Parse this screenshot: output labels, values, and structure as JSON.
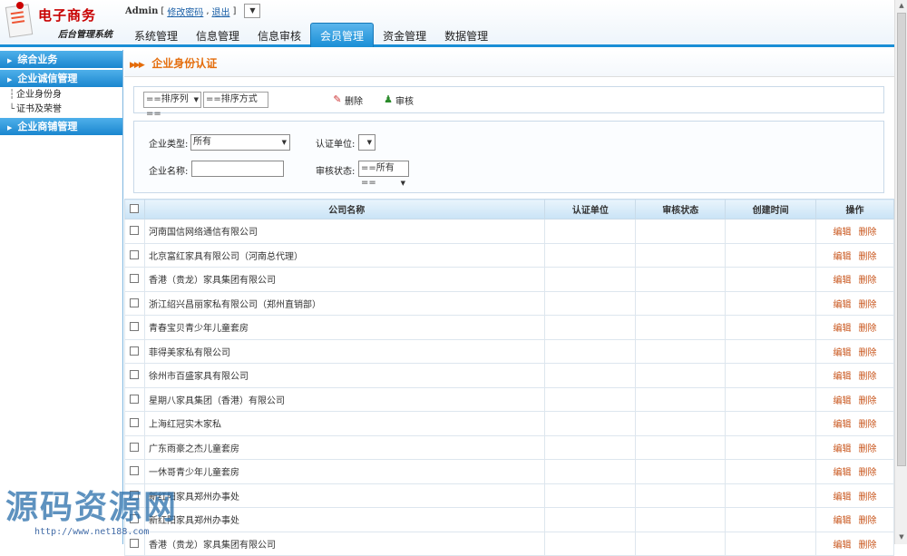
{
  "logo": {
    "title": "电子商务",
    "subtitle": "后台管理系统"
  },
  "userbar": {
    "user": "Admin",
    "open_bracket": "[",
    "change_password": "修改密码",
    "sep": ",",
    "logout": "退出",
    "close_bracket": "]",
    "dropdown": "▼"
  },
  "nav": {
    "tabs": [
      "系统管理",
      "信息管理",
      "信息审核",
      "会员管理",
      "资金管理",
      "数据管理"
    ],
    "active": "会员管理"
  },
  "sidebar": {
    "groups": [
      {
        "label": "综合业务"
      },
      {
        "label": "企业诚信管理",
        "items": [
          "企业身份身",
          "证书及荣誉"
        ]
      },
      {
        "label": "企业商铺管理"
      }
    ]
  },
  "page": {
    "title": "企业身份认证"
  },
  "toolbar": {
    "sort_column": "==排序列==",
    "sort_order": "==排序方式",
    "delete_label": "删除",
    "audit_label": "审核"
  },
  "filter": {
    "type_label": "企业类型:",
    "type_value": "所有",
    "unit_label": "认证单位:",
    "name_label": "企业名称:",
    "name_value": "",
    "status_label": "审核状态:",
    "status_value": "==所有=="
  },
  "table": {
    "columns": [
      "公司名称",
      "认证单位",
      "审核状态",
      "创建时间",
      "操作"
    ],
    "rows": [
      "河南国信网络通信有限公司",
      "北京富红家具有限公司（河南总代理）",
      "香港（贵龙）家具集团有限公司",
      "浙江绍兴昌丽家私有限公司（郑州直销部）",
      "青春宝贝青少年儿童套房",
      "菲得美家私有限公司",
      "徐州市百盛家具有限公司",
      "星期八家具集团（香港）有限公司",
      "上海红冠实木家私",
      "广东雨豪之杰儿童套房",
      "一休哥青少年儿童套房",
      "新红阳家具郑州办事处",
      "新红阳家具郑州办事处",
      "香港（贵龙）家具集团有限公司"
    ],
    "edit_label": "编辑",
    "delete_label": "删除"
  },
  "watermark": {
    "text": "源码资源网",
    "url": "http://www.net188.com"
  },
  "colors": {
    "accent": "#1a8fd6",
    "title_orange": "#e46c0a",
    "link_orange": "#c8541a"
  }
}
